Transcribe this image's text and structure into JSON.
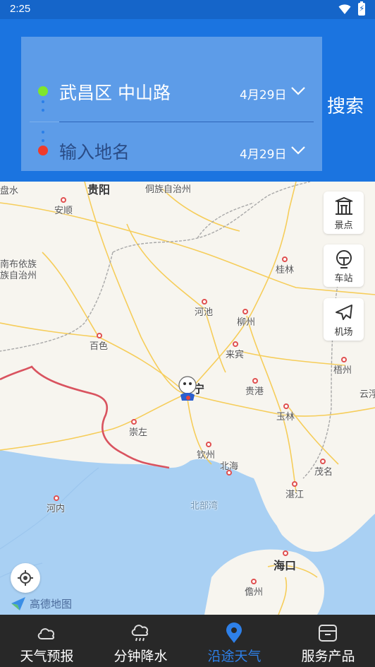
{
  "status_bar": {
    "time": "2:25"
  },
  "route": {
    "start": {
      "place": "武昌区 中山路",
      "date": "4月29日"
    },
    "end": {
      "placeholder": "输入地名",
      "date": "4月29日"
    },
    "search_label": "搜索"
  },
  "map": {
    "cities": [
      {
        "name": "贵阳",
        "big": true
      },
      {
        "name": "侗族自治州"
      },
      {
        "name": "盘水"
      },
      {
        "name": "安顺"
      },
      {
        "name": "南布依族"
      },
      {
        "name": "族自治州"
      },
      {
        "name": "桂林"
      },
      {
        "name": "河池"
      },
      {
        "name": "柳州"
      },
      {
        "name": "百色"
      },
      {
        "name": "来宾"
      },
      {
        "name": "梧州"
      },
      {
        "name": "贵港"
      },
      {
        "name": "云浮"
      },
      {
        "name": "宁"
      },
      {
        "name": "崇左"
      },
      {
        "name": "玉林"
      },
      {
        "name": "钦州"
      },
      {
        "name": "北海"
      },
      {
        "name": "茂名"
      },
      {
        "name": "湛江"
      },
      {
        "name": "河内"
      },
      {
        "name": "北部湾",
        "sea": true
      },
      {
        "name": "海口",
        "big": true
      },
      {
        "name": "儋州"
      }
    ],
    "side_buttons": [
      {
        "label": "景点",
        "icon": "scenic-spot-icon"
      },
      {
        "label": "车站",
        "icon": "station-icon"
      },
      {
        "label": "机场",
        "icon": "airport-icon"
      }
    ],
    "logo_text": "高德地图"
  },
  "bottom_nav": [
    {
      "label": "天气预报",
      "icon": "cloud-icon",
      "active": false
    },
    {
      "label": "分钟降水",
      "icon": "rain-cloud-icon",
      "active": false
    },
    {
      "label": "沿途天气",
      "icon": "location-pin-icon",
      "active": true
    },
    {
      "label": "服务产品",
      "icon": "service-box-icon",
      "active": false
    }
  ],
  "colors": {
    "status_bar": "#1565c9",
    "header": "#1b74e0",
    "route_card": "#5d9ce8",
    "nav_active": "#2e80e8",
    "nav_bg": "#282828"
  }
}
